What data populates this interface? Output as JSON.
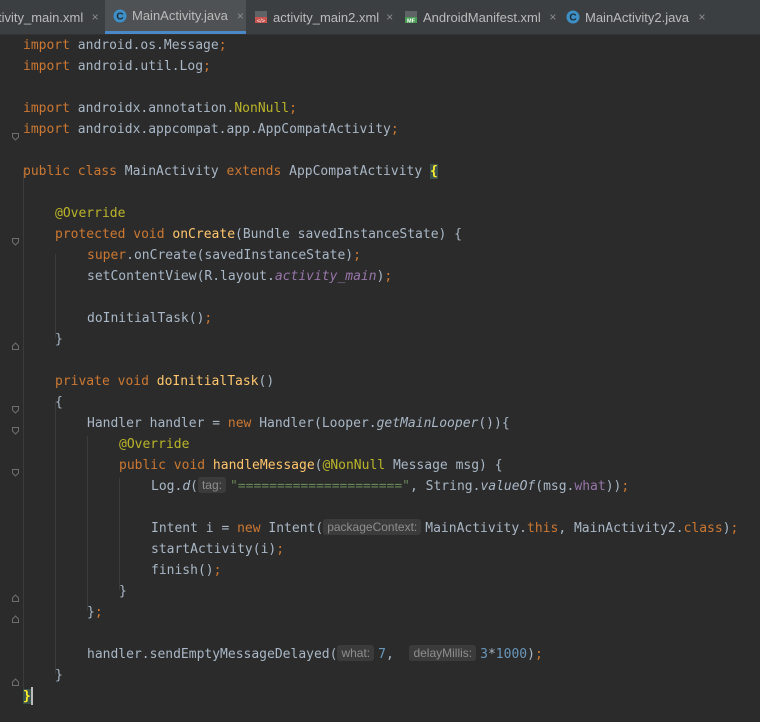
{
  "tabs": [
    {
      "label": "tivity_main.xml",
      "icon": "xml-file-icon"
    },
    {
      "label": "MainActivity.java",
      "icon": "java-class-icon",
      "active": true
    },
    {
      "label": "activity_main2.xml",
      "icon": "xml-file-icon"
    },
    {
      "label": "AndroidManifest.xml",
      "icon": "manifest-file-icon"
    },
    {
      "label": "MainActivity2.java",
      "icon": "java-class-icon"
    }
  ],
  "close_glyph": "×",
  "code": {
    "l1_kw": "import",
    "l1_rest": " android.os.Message",
    "l1_semi": ";",
    "l2_kw": "import",
    "l2_rest": " android.util.Log",
    "l2_semi": ";",
    "l3_kw": "import",
    "l3_rest": " androidx.annotation.",
    "l3_ann": "NonNull",
    "l3_semi": ";",
    "l4_kw": "import",
    "l4_rest": " androidx.appcompat.app.AppCompatActivity",
    "l4_semi": ";",
    "l5_kw": "public class",
    "l5_name": " MainActivity ",
    "l5_kw2": "extends",
    "l5_parent": " AppCompatActivity ",
    "l5_brace": "{",
    "l6_ann": "@Override",
    "l7_kw": "protected void",
    "l7_fn": " onCreate",
    "l7_rest": "(Bundle savedInstanceState) {",
    "l8_kw": "super",
    "l8_rest": ".onCreate(savedInstanceState)",
    "l8_semi": ";",
    "l9_a": "setContentView(R.layout.",
    "l9_fld": "activity_main",
    "l9_b": ")",
    "l9_semi": ";",
    "l10_a": "doInitialTask()",
    "l10_semi": ";",
    "l11": "}",
    "l12_kw": "private void",
    "l12_fn": " doInitialTask",
    "l12_rest": "()",
    "l13": "{",
    "l14_a": "Handler handler = ",
    "l14_kw": "new",
    "l14_b": " Handler(Looper.",
    "l14_it": "getMainLooper",
    "l14_c": "()){",
    "l15_ann": "@Override",
    "l16_kw": "public void",
    "l16_fn": " handleMessage",
    "l16_a": "(",
    "l16_ann": "@NonNull",
    "l16_b": " Message msg) {",
    "l17_a": "Log.",
    "l17_it": "d",
    "l17_b": "(",
    "l17_hint": "tag:",
    "l17_str": "\"=====================\"",
    "l17_c": ", String.",
    "l17_it2": "valueOf",
    "l17_d": "(msg.",
    "l17_fld": "what",
    "l17_e": "))",
    "l17_semi": ";",
    "l18_a": "Intent i = ",
    "l18_kw": "new",
    "l18_b": " Intent(",
    "l18_hint": "packageContext:",
    "l18_c": "MainActivity.",
    "l18_kw2": "this",
    "l18_d": ", MainActivity2.",
    "l18_kw3": "class",
    "l18_e": ")",
    "l18_semi": ";",
    "l19_a": "startActivity(i)",
    "l19_semi": ";",
    "l20_a": "finish()",
    "l20_semi": ";",
    "l21": "}",
    "l22_a": "}",
    "l22_semi": ";",
    "l23_a": "handler.sendEmptyMessageDelayed(",
    "l23_hint1": "what:",
    "l23_n1": "7",
    "l23_b": ",  ",
    "l23_hint2": "delayMillis:",
    "l23_n2": "3",
    "l23_op": "*",
    "l23_n3": "1000",
    "l23_c": ")",
    "l23_semi": ";",
    "l24": "}",
    "l25": "}"
  },
  "colors": {
    "background": "#2b2b2b",
    "keyword": "#cc7832",
    "annotation": "#bbb529",
    "method": "#ffc66d",
    "string": "#6a8759",
    "number": "#6897bb",
    "field": "#9876aa",
    "text": "#a9b7c6"
  }
}
